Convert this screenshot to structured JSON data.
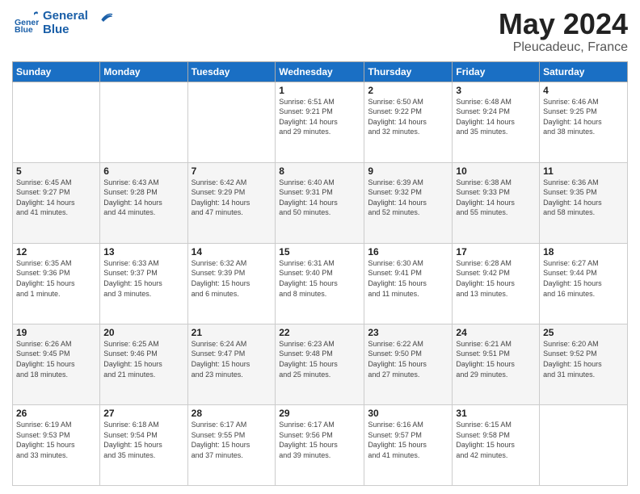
{
  "header": {
    "logo_line1": "General",
    "logo_line2": "Blue",
    "month": "May 2024",
    "location": "Pleucadeuc, France"
  },
  "weekdays": [
    "Sunday",
    "Monday",
    "Tuesday",
    "Wednesday",
    "Thursday",
    "Friday",
    "Saturday"
  ],
  "weeks": [
    [
      {
        "day": "",
        "info": ""
      },
      {
        "day": "",
        "info": ""
      },
      {
        "day": "",
        "info": ""
      },
      {
        "day": "1",
        "info": "Sunrise: 6:51 AM\nSunset: 9:21 PM\nDaylight: 14 hours\nand 29 minutes."
      },
      {
        "day": "2",
        "info": "Sunrise: 6:50 AM\nSunset: 9:22 PM\nDaylight: 14 hours\nand 32 minutes."
      },
      {
        "day": "3",
        "info": "Sunrise: 6:48 AM\nSunset: 9:24 PM\nDaylight: 14 hours\nand 35 minutes."
      },
      {
        "day": "4",
        "info": "Sunrise: 6:46 AM\nSunset: 9:25 PM\nDaylight: 14 hours\nand 38 minutes."
      }
    ],
    [
      {
        "day": "5",
        "info": "Sunrise: 6:45 AM\nSunset: 9:27 PM\nDaylight: 14 hours\nand 41 minutes."
      },
      {
        "day": "6",
        "info": "Sunrise: 6:43 AM\nSunset: 9:28 PM\nDaylight: 14 hours\nand 44 minutes."
      },
      {
        "day": "7",
        "info": "Sunrise: 6:42 AM\nSunset: 9:29 PM\nDaylight: 14 hours\nand 47 minutes."
      },
      {
        "day": "8",
        "info": "Sunrise: 6:40 AM\nSunset: 9:31 PM\nDaylight: 14 hours\nand 50 minutes."
      },
      {
        "day": "9",
        "info": "Sunrise: 6:39 AM\nSunset: 9:32 PM\nDaylight: 14 hours\nand 52 minutes."
      },
      {
        "day": "10",
        "info": "Sunrise: 6:38 AM\nSunset: 9:33 PM\nDaylight: 14 hours\nand 55 minutes."
      },
      {
        "day": "11",
        "info": "Sunrise: 6:36 AM\nSunset: 9:35 PM\nDaylight: 14 hours\nand 58 minutes."
      }
    ],
    [
      {
        "day": "12",
        "info": "Sunrise: 6:35 AM\nSunset: 9:36 PM\nDaylight: 15 hours\nand 1 minute."
      },
      {
        "day": "13",
        "info": "Sunrise: 6:33 AM\nSunset: 9:37 PM\nDaylight: 15 hours\nand 3 minutes."
      },
      {
        "day": "14",
        "info": "Sunrise: 6:32 AM\nSunset: 9:39 PM\nDaylight: 15 hours\nand 6 minutes."
      },
      {
        "day": "15",
        "info": "Sunrise: 6:31 AM\nSunset: 9:40 PM\nDaylight: 15 hours\nand 8 minutes."
      },
      {
        "day": "16",
        "info": "Sunrise: 6:30 AM\nSunset: 9:41 PM\nDaylight: 15 hours\nand 11 minutes."
      },
      {
        "day": "17",
        "info": "Sunrise: 6:28 AM\nSunset: 9:42 PM\nDaylight: 15 hours\nand 13 minutes."
      },
      {
        "day": "18",
        "info": "Sunrise: 6:27 AM\nSunset: 9:44 PM\nDaylight: 15 hours\nand 16 minutes."
      }
    ],
    [
      {
        "day": "19",
        "info": "Sunrise: 6:26 AM\nSunset: 9:45 PM\nDaylight: 15 hours\nand 18 minutes."
      },
      {
        "day": "20",
        "info": "Sunrise: 6:25 AM\nSunset: 9:46 PM\nDaylight: 15 hours\nand 21 minutes."
      },
      {
        "day": "21",
        "info": "Sunrise: 6:24 AM\nSunset: 9:47 PM\nDaylight: 15 hours\nand 23 minutes."
      },
      {
        "day": "22",
        "info": "Sunrise: 6:23 AM\nSunset: 9:48 PM\nDaylight: 15 hours\nand 25 minutes."
      },
      {
        "day": "23",
        "info": "Sunrise: 6:22 AM\nSunset: 9:50 PM\nDaylight: 15 hours\nand 27 minutes."
      },
      {
        "day": "24",
        "info": "Sunrise: 6:21 AM\nSunset: 9:51 PM\nDaylight: 15 hours\nand 29 minutes."
      },
      {
        "day": "25",
        "info": "Sunrise: 6:20 AM\nSunset: 9:52 PM\nDaylight: 15 hours\nand 31 minutes."
      }
    ],
    [
      {
        "day": "26",
        "info": "Sunrise: 6:19 AM\nSunset: 9:53 PM\nDaylight: 15 hours\nand 33 minutes."
      },
      {
        "day": "27",
        "info": "Sunrise: 6:18 AM\nSunset: 9:54 PM\nDaylight: 15 hours\nand 35 minutes."
      },
      {
        "day": "28",
        "info": "Sunrise: 6:17 AM\nSunset: 9:55 PM\nDaylight: 15 hours\nand 37 minutes."
      },
      {
        "day": "29",
        "info": "Sunrise: 6:17 AM\nSunset: 9:56 PM\nDaylight: 15 hours\nand 39 minutes."
      },
      {
        "day": "30",
        "info": "Sunrise: 6:16 AM\nSunset: 9:57 PM\nDaylight: 15 hours\nand 41 minutes."
      },
      {
        "day": "31",
        "info": "Sunrise: 6:15 AM\nSunset: 9:58 PM\nDaylight: 15 hours\nand 42 minutes."
      },
      {
        "day": "",
        "info": ""
      }
    ]
  ]
}
